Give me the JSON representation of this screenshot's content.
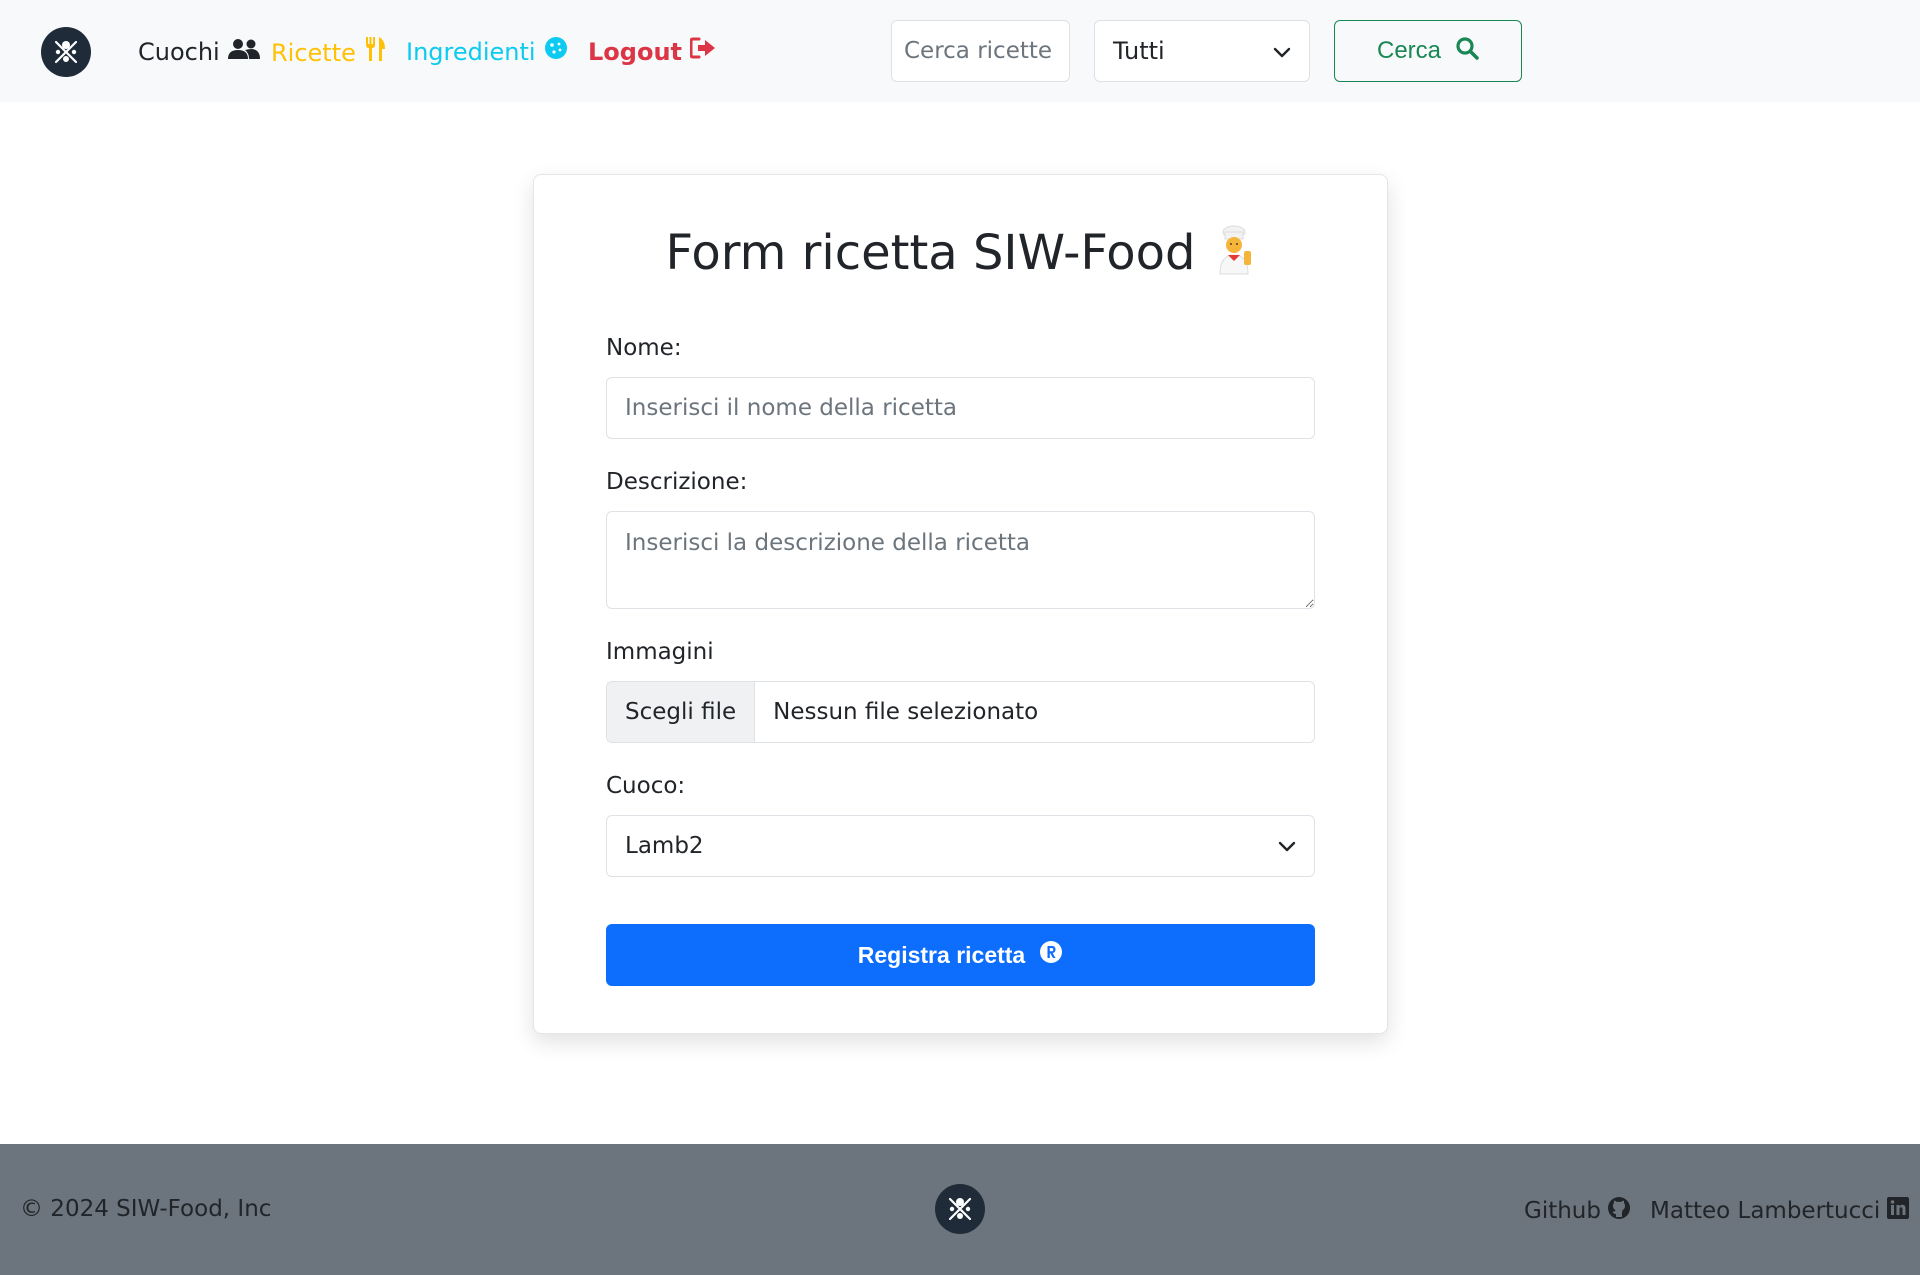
{
  "navbar": {
    "logo_icon": "siw-food-logo-icon",
    "links": [
      {
        "label": "Cuochi",
        "icon": "users-icon",
        "color": "#212529"
      },
      {
        "label": "Ricette",
        "icon": "utensils-icon",
        "color": "#ffc107"
      },
      {
        "label": "Ingredienti",
        "icon": "cookie-icon",
        "color": "#0dcaf0"
      },
      {
        "label": "Logout",
        "icon": "sign-out-icon",
        "color": "#dc3545"
      }
    ],
    "search": {
      "placeholder": "Cerca ricette",
      "value": "",
      "filter_selected": "Tutti",
      "button_label": "Cerca",
      "button_color": "#198754"
    }
  },
  "form": {
    "title": "Form ricetta SIW-Food",
    "title_emoji": "chef-icon",
    "nome": {
      "label": "Nome:",
      "placeholder": "Inserisci il nome della ricetta",
      "value": ""
    },
    "descrizione": {
      "label": "Descrizione:",
      "placeholder": "Inserisci la descrizione della ricetta",
      "value": ""
    },
    "immagini": {
      "label": "Immagini",
      "button_label": "Scegli file",
      "status": "Nessun file selezionato"
    },
    "cuoco": {
      "label": "Cuoco:",
      "selected": "Lamb2"
    },
    "submit_label": "Registra ricetta",
    "submit_color": "#0d6efd"
  },
  "footer": {
    "copyright": "© 2024 SIW-Food, Inc",
    "links": [
      {
        "label": "Github",
        "icon": "github-icon"
      },
      {
        "label": "Matteo Lambertucci",
        "icon": "linkedin-icon"
      }
    ]
  }
}
